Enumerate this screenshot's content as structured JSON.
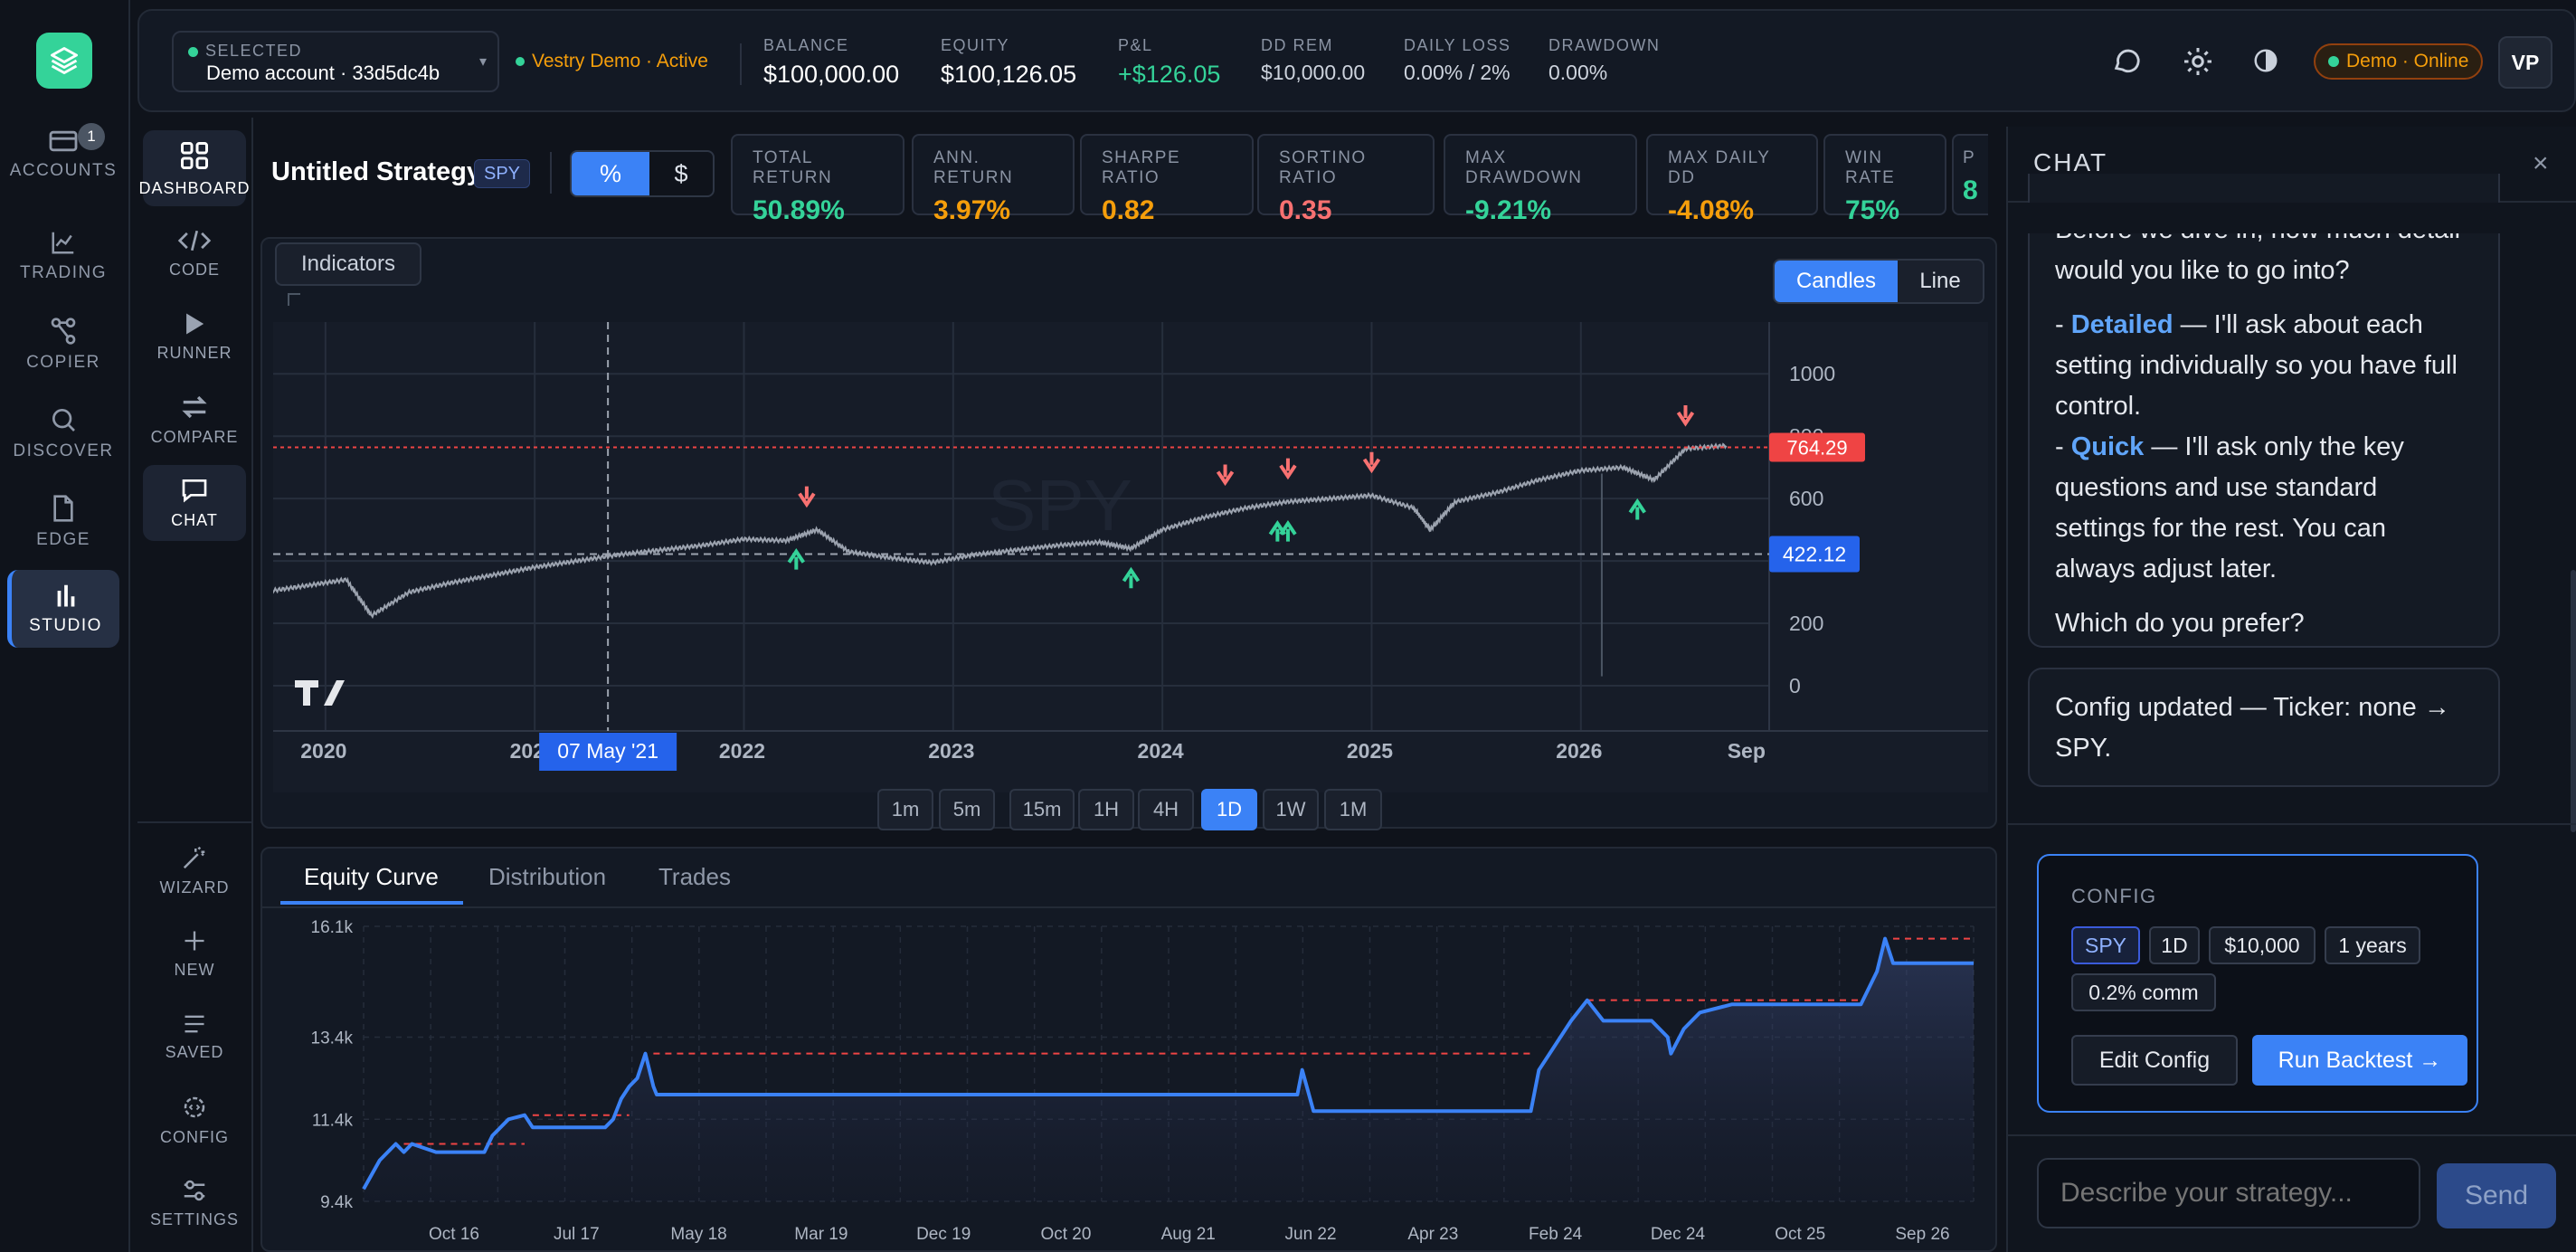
{
  "rail": {
    "items": [
      {
        "label": "ACCOUNTS",
        "badge": "1"
      },
      {
        "label": "TRADING"
      },
      {
        "label": "COPIER"
      },
      {
        "label": "DISCOVER"
      },
      {
        "label": "EDGE"
      },
      {
        "label": "STUDIO"
      }
    ]
  },
  "rail2": {
    "top": [
      "DASHBOARD",
      "CODE",
      "RUNNER",
      "COMPARE",
      "CHAT"
    ],
    "bottom": [
      "WIZARD",
      "NEW",
      "SAVED",
      "CONFIG",
      "SETTINGS"
    ]
  },
  "topbar": {
    "selected_label": "SELECTED",
    "account": "Demo account · 33d5dc4b",
    "server": "Vestry Demo · Active",
    "kpis": [
      {
        "label": "BALANCE",
        "value": "$100,000.00"
      },
      {
        "label": "EQUITY",
        "value": "$100,126.05"
      },
      {
        "label": "P&L",
        "value": "+$126.05"
      },
      {
        "label": "DD REM",
        "value": "$10,000.00"
      },
      {
        "label": "DAILY LOSS",
        "value": "0.00% / 2%"
      },
      {
        "label": "DRAWDOWN",
        "value": "0.00%"
      }
    ],
    "status": "Demo · Online",
    "avatar": "VP"
  },
  "strategy": {
    "name": "Untitled Strategy",
    "ticker": "SPY",
    "toggle": [
      "%",
      "$"
    ],
    "metrics": [
      {
        "label": "TOTAL RETURN",
        "value": "50.89%",
        "color": "#34d399"
      },
      {
        "label": "ANN. RETURN",
        "value": "3.97%",
        "color": "#f59e0b"
      },
      {
        "label": "SHARPE RATIO",
        "value": "0.82",
        "color": "#f59e0b"
      },
      {
        "label": "SORTINO RATIO",
        "value": "0.35",
        "color": "#f87171"
      },
      {
        "label": "MAX DRAWDOWN",
        "value": "-9.21%",
        "color": "#34d399"
      },
      {
        "label": "MAX DAILY DD",
        "value": "-4.08%",
        "color": "#f59e0b"
      },
      {
        "label": "WIN RATE",
        "value": "75%",
        "color": "#34d399"
      },
      {
        "label": "P",
        "value": "8",
        "color": "#34d399"
      }
    ]
  },
  "price_chart": {
    "indicators": "Indicators",
    "modes": [
      "Candles",
      "Line"
    ],
    "watermark": "SPY",
    "crosshair_date": "07 May '21",
    "last_price": "764.29",
    "crosshair_price": "422.12",
    "timeframes": [
      "1m",
      "5m",
      "15m",
      "1H",
      "4H",
      "1D",
      "1W",
      "1M"
    ],
    "active_timeframe": "1D"
  },
  "chart_data": [
    {
      "type": "line",
      "title": "",
      "x_ticks": [
        "2020",
        "2021",
        "2022",
        "2023",
        "2024",
        "2025",
        "2026",
        "Sep"
      ],
      "y_ticks": [
        "1000",
        "800",
        "600",
        "400",
        "200",
        "0"
      ],
      "ylim": [
        0,
        1050
      ],
      "series": [
        {
          "x": [
            2019.7,
            2019.9,
            2020.1,
            2020.22,
            2020.4,
            2020.6,
            2020.8,
            2021.0,
            2021.2,
            2021.4,
            2021.6,
            2021.8,
            2022.0,
            2022.2,
            2022.35,
            2022.5,
            2022.7,
            2022.9,
            2023.1,
            2023.3,
            2023.5,
            2023.7,
            2023.85,
            2024.0,
            2024.2,
            2024.4,
            2024.6,
            2024.8,
            2025.0,
            2025.2,
            2025.28,
            2025.4,
            2025.6,
            2025.8,
            2026.0,
            2026.2,
            2026.35,
            2026.5,
            2026.7
          ],
          "y": [
            300,
            320,
            340,
            225,
            300,
            330,
            355,
            380,
            400,
            420,
            435,
            450,
            470,
            465,
            500,
            430,
            410,
            395,
            420,
            435,
            450,
            460,
            440,
            500,
            540,
            570,
            590,
            600,
            610,
            570,
            500,
            590,
            620,
            660,
            690,
            700,
            660,
            760,
            770
          ]
        }
      ],
      "buy_markers": [
        2022.25,
        2023.85,
        2024.55,
        2024.6,
        2026.27
      ],
      "sell_markers": [
        2022.3,
        2024.3,
        2024.6,
        2025.0,
        2026.5
      ],
      "grid": true
    },
    {
      "type": "area",
      "title": "",
      "x_ticks": [
        "Oct 16",
        "Jul 17",
        "May 18",
        "Mar 19",
        "Dec 19",
        "Oct 20",
        "Aug 21",
        "Jun 22",
        "Apr 23",
        "Feb 24",
        "Dec 24",
        "Oct 25",
        "Sep 26"
      ],
      "y_ticks": [
        "16.1k",
        "13.4k",
        "11.4k",
        "9.4k"
      ],
      "ylim": [
        9400,
        16100
      ],
      "series": [
        {
          "name": "Equity",
          "x": [
            0,
            0.01,
            0.02,
            0.025,
            0.03,
            0.045,
            0.075,
            0.08,
            0.09,
            0.1,
            0.105,
            0.13,
            0.15,
            0.155,
            0.16,
            0.165,
            0.17,
            0.175,
            0.18,
            0.182,
            0.185,
            0.19,
            0.58,
            0.583,
            0.59,
            0.725,
            0.73,
            0.75,
            0.76,
            0.77,
            0.8,
            0.81,
            0.812,
            0.82,
            0.83,
            0.85,
            0.92,
            0.93,
            0.94,
            0.945,
            0.95,
            0.97,
            1.0
          ],
          "y": [
            9700,
            10400,
            10800,
            10600,
            10800,
            10600,
            10600,
            11000,
            11400,
            11500,
            11200,
            11200,
            11200,
            11400,
            11900,
            12200,
            12400,
            13000,
            12200,
            12000,
            12000,
            12000,
            12000,
            12600,
            11600,
            11600,
            12600,
            13800,
            14300,
            13800,
            13800,
            13400,
            13000,
            13600,
            14000,
            14200,
            14200,
            14200,
            15000,
            15800,
            15200,
            15200,
            15200
          ]
        }
      ],
      "drawdown_segments": [
        [
          0.025,
          0.1
        ],
        [
          0.105,
          0.165
        ],
        [
          0.18,
          0.725
        ],
        [
          0.76,
          0.8
        ],
        [
          0.8,
          0.93
        ],
        [
          0.95,
          1.0
        ]
      ],
      "grid": true
    }
  ],
  "equity": {
    "tabs": [
      "Equity Curve",
      "Distribution",
      "Trades"
    ]
  },
  "chat": {
    "title": "CHAT",
    "message1": {
      "intro": "Before we dive in, how much detail would you like to go into?",
      "opt1_name": "Detailed",
      "opt1_text": " — I'll ask about each setting individually so you have full control.",
      "opt2_name": "Quick",
      "opt2_text": " — I'll ask only the key questions and use standard settings for the rest. You can always adjust later.",
      "question": "Which do you prefer?"
    },
    "message2": "Config updated — Ticker: none → SPY.",
    "config": {
      "label": "CONFIG",
      "chips": [
        "SPY",
        "1D",
        "$10,000",
        "1 years",
        "0.2% comm"
      ],
      "edit": "Edit Config",
      "run": "Run Backtest →"
    },
    "input_placeholder": "Describe your strategy...",
    "send": "Send"
  },
  "colors": {
    "accent": "#3b82f6",
    "green": "#34d399",
    "red": "#f87171",
    "orange": "#f59e0b"
  }
}
